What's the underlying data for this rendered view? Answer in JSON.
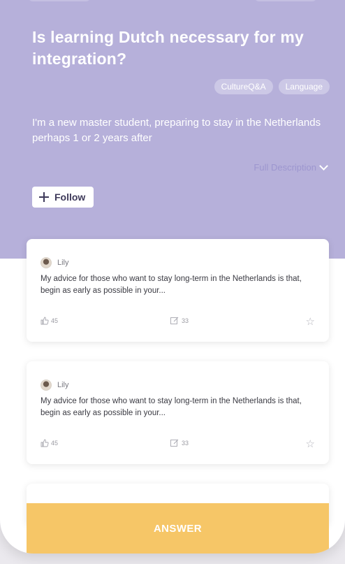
{
  "question": {
    "title": "Is learning Dutch necessary for my integration?",
    "tags": [
      "CultureQ&A",
      "Language"
    ],
    "description": "I'm a new master student, preparing to stay in the Netherlands perhaps 1 or 2 years after",
    "full_description_label": "Full Description"
  },
  "follow_label": "Follow",
  "answers": [
    {
      "author": "Lily",
      "excerpt": "My advice for those who want to stay long-term in the Netherlands is that, begin as early as possible in your...",
      "likes": "45",
      "comments": "33"
    },
    {
      "author": "Lily",
      "excerpt": "My advice for those who want to stay long-term in the Netherlands is that, begin as early as possible in your...",
      "likes": "45",
      "comments": "33"
    }
  ],
  "answer_button_label": "ANSWER",
  "colors": {
    "header": "#b6b0da",
    "accent_text": "#9d96cf",
    "answer_button": "#f6c667"
  },
  "icons": {
    "follow": "plus-icon",
    "like": "thumbs-up-icon",
    "comment": "comment-icon",
    "favorite": "star-icon",
    "expand": "chevron-down-icon"
  }
}
